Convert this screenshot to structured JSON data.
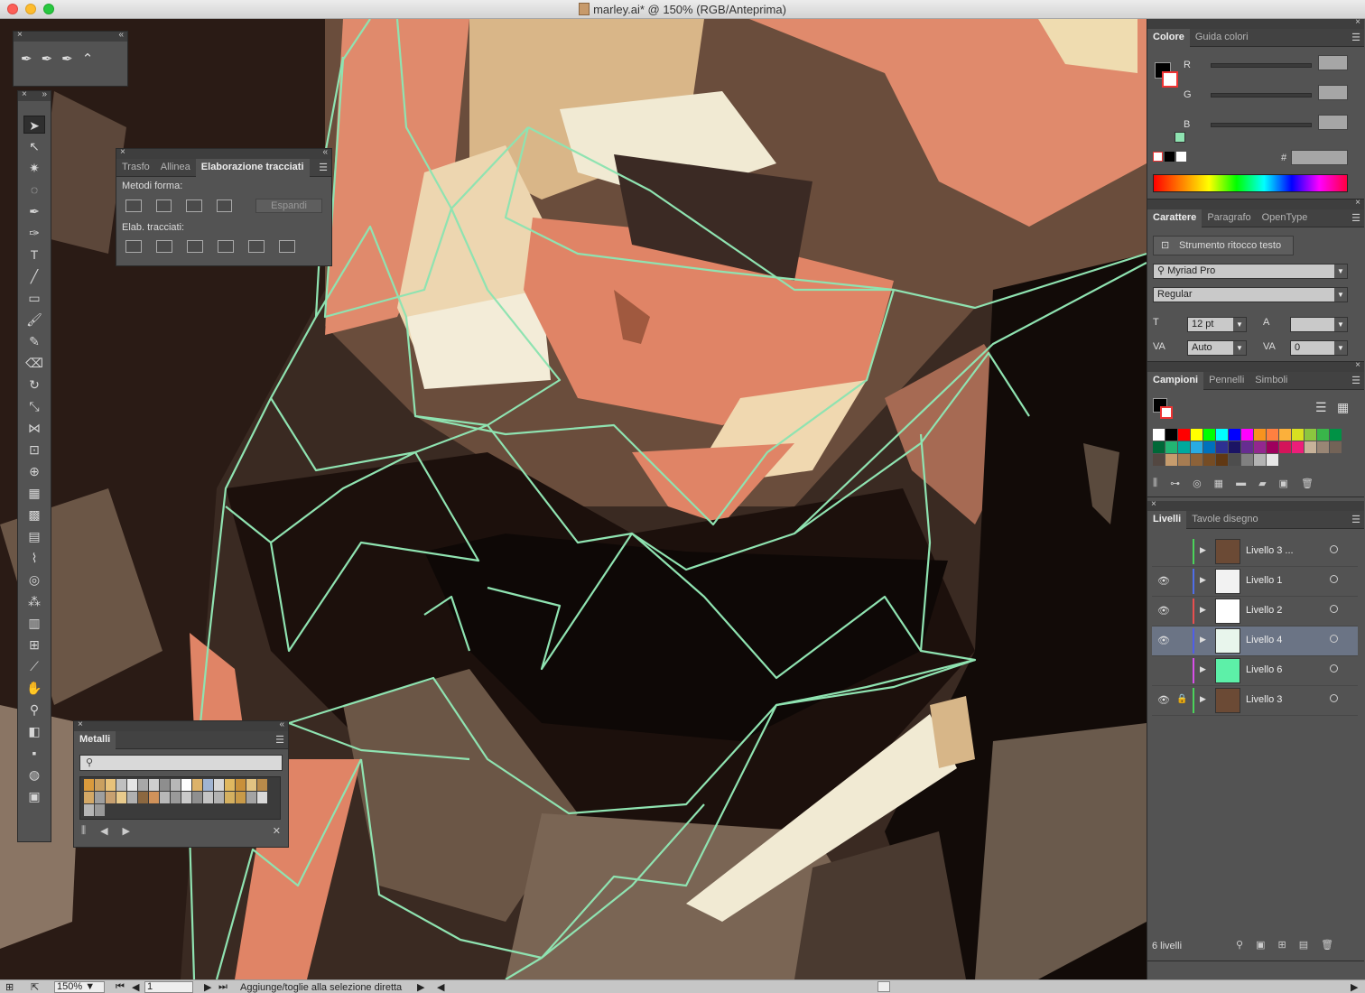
{
  "window": {
    "title": "marley.ai* @ 150% (RGB/Anteprima)"
  },
  "pathfinder": {
    "tabs": [
      "Trasfo",
      "Allinea",
      "Elaborazione tracciati"
    ],
    "shape_modes_label": "Metodi forma:",
    "expand_label": "Espandi",
    "pathfinders_label": "Elab. tracciati:"
  },
  "metals": {
    "tab": "Metalli",
    "swatches": [
      "#d99a3c",
      "#caa060",
      "#e8c27a",
      "#c0c0c0",
      "#e6e6e6",
      "#a8a8a8",
      "#cfcfcf",
      "#8e8e8e",
      "#b7b7b7",
      "#ffffff",
      "#dcb26a",
      "#a0b4d2",
      "#d6d6d6",
      "#e0b860",
      "#c8903a",
      "#e2c382",
      "#b88a4a",
      "#d3a866",
      "#9e9e9e",
      "#c7a070",
      "#e8ca8c",
      "#b0b0b0",
      "#8c6840",
      "#d0925a",
      "#b8b8b8",
      "#9a9a9a",
      "#cacaca",
      "#8f8f8f",
      "#c4c4c4",
      "#b2b2b2",
      "#d4b060",
      "#c89a48",
      "#a3a3a3",
      "#d9d9d9",
      "#b5b5b5",
      "#999999"
    ]
  },
  "color_panel": {
    "tabs": [
      "Colore",
      "Guida colori"
    ],
    "channels": [
      "R",
      "G",
      "B"
    ],
    "hex_label": "#",
    "accent": "#8fe3b1"
  },
  "character": {
    "tabs": [
      "Carattere",
      "Paragrafo",
      "OpenType"
    ],
    "touch_type": "Strumento ritocco testo",
    "font": "Myriad Pro",
    "style": "Regular",
    "size": "12 pt",
    "kerning": "Auto",
    "tracking": "0"
  },
  "swatches_panel": {
    "tabs": [
      "Campioni",
      "Pennelli",
      "Simboli"
    ],
    "colors": [
      "#ffffff",
      "#000000",
      "#ff0000",
      "#ffff00",
      "#00ff00",
      "#00ffff",
      "#0000ff",
      "#ff00ff",
      "#f7931e",
      "#ff8040",
      "#fbb03b",
      "#d9e021",
      "#8cc63f",
      "#39b54a",
      "#009245",
      "#006837",
      "#22b573",
      "#00a99d",
      "#29abe2",
      "#0071bc",
      "#2e3192",
      "#1b1464",
      "#662d91",
      "#93278f",
      "#9e005d",
      "#d4145a",
      "#ed1e79",
      "#c7b299",
      "#998675",
      "#736357",
      "#534741",
      "#c69c6d",
      "#a67c52",
      "#8c6239",
      "#754c24",
      "#603813",
      "#4d4d4d",
      "#808080",
      "#b3b3b3",
      "#e6e6e6"
    ]
  },
  "layers": {
    "tabs": [
      "Livelli",
      "Tavole disegno"
    ],
    "count": "6 livelli",
    "items": [
      {
        "name": "Livello 3 ...",
        "visible": false,
        "locked": false,
        "color": "#4bd35a",
        "thumb": "#6b4a35"
      },
      {
        "name": "Livello 1",
        "visible": true,
        "locked": false,
        "color": "#4f6ee8",
        "thumb": "#f2f2f2"
      },
      {
        "name": "Livello 2",
        "visible": true,
        "locked": false,
        "color": "#e84f4f",
        "thumb": "#ffffff"
      },
      {
        "name": "Livello 4",
        "visible": true,
        "locked": false,
        "color": "#4f5ee8",
        "thumb": "#e8f5ec",
        "selected": true
      },
      {
        "name": "Livello 6",
        "visible": false,
        "locked": false,
        "color": "#d84fe8",
        "thumb": "#5df0a8"
      },
      {
        "name": "Livello 3",
        "visible": true,
        "locked": true,
        "color": "#4bd35a",
        "thumb": "#6b4a35"
      }
    ]
  },
  "status": {
    "zoom": "150%",
    "page": "1",
    "message": "Aggiunge/toglie alla selezione diretta"
  }
}
